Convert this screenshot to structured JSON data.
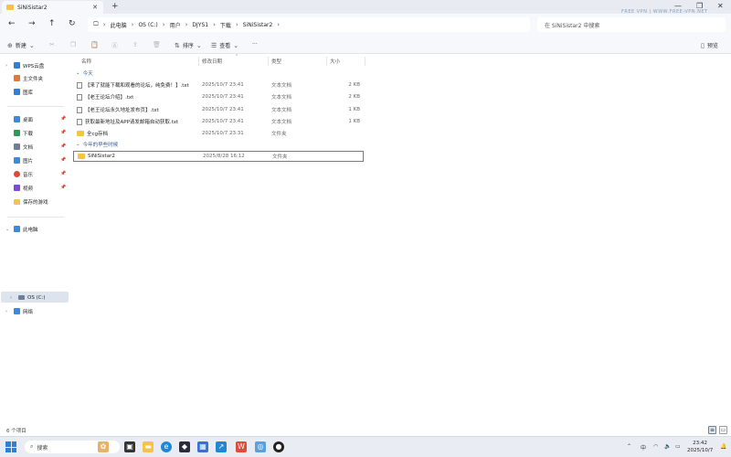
{
  "window": {
    "tab_title": "SiNiSistar2",
    "new_tab_label": "+",
    "watermark": "FREE VPN | WWW.FREE-VPN.NET"
  },
  "nav": {
    "breadcrumbs": [
      "此电脑",
      "OS (C:)",
      "用户",
      "DJYS1",
      "下载",
      "SiNiSistar2"
    ],
    "search_placeholder": "在 SiNiSistar2 中搜索"
  },
  "toolbar": {
    "new_label": "新建",
    "sort_label": "排序",
    "view_label": "查看",
    "more_label": "···",
    "preview_label": "预览"
  },
  "sidebar": {
    "items": [
      {
        "label": "WPS云盘",
        "icon": "cloud-icon",
        "color": "#2f7fd6"
      },
      {
        "label": "主文件夹",
        "icon": "home-icon",
        "color": "#e07a3a"
      },
      {
        "label": "图库",
        "icon": "gallery-icon",
        "color": "#2f7fd6"
      },
      {
        "label": "桌面",
        "icon": "desktop-icon",
        "color": "#3a8be0"
      },
      {
        "label": "下载",
        "icon": "download-icon",
        "color": "#2f9a58"
      },
      {
        "label": "文档",
        "icon": "document-icon",
        "color": "#6f7f95"
      },
      {
        "label": "图片",
        "icon": "picture-icon",
        "color": "#3a8be0"
      },
      {
        "label": "音乐",
        "icon": "music-icon",
        "color": "#e04a3a"
      },
      {
        "label": "视频",
        "icon": "video-icon",
        "color": "#7a4ae0"
      },
      {
        "label": "保存的游戏",
        "icon": "folder-icon",
        "color": "#f6c34a"
      },
      {
        "label": "此电脑",
        "icon": "computer-icon",
        "color": "#3a8be0"
      },
      {
        "label": "OS (C:)",
        "icon": "drive-icon",
        "color": "#6f7f95"
      },
      {
        "label": "网络",
        "icon": "network-icon",
        "color": "#3a8be0"
      }
    ]
  },
  "list": {
    "columns": [
      "名称",
      "修改日期",
      "类型",
      "大小"
    ],
    "groups": [
      {
        "label": "今天",
        "rows": [
          {
            "name": "【来了就能下载和观看的论坛，纯免费！】.txt",
            "date": "2025/10/7 23:41",
            "type": "文本文档",
            "size": "2 KB",
            "kind": "txt"
          },
          {
            "name": "【老王论坛介绍】.txt",
            "date": "2025/10/7 23:41",
            "type": "文本文档",
            "size": "2 KB",
            "kind": "txt"
          },
          {
            "name": "【老王论坛永久地址发布页】.txt",
            "date": "2025/10/7 23:41",
            "type": "文本文档",
            "size": "1 KB",
            "kind": "txt"
          },
          {
            "name": "获取最新地址及APP请发邮箱自动获取.txt",
            "date": "2025/10/7 23:41",
            "type": "文本文档",
            "size": "1 KB",
            "kind": "txt"
          },
          {
            "name": "全cg存档",
            "date": "2025/10/7 23:31",
            "type": "文件夹",
            "size": "",
            "kind": "folder"
          }
        ]
      },
      {
        "label": "今年的早些时候",
        "rows": [
          {
            "name": "SiNiSistar2",
            "date": "2025/8/28 16:12",
            "type": "文件夹",
            "size": "",
            "kind": "folder"
          }
        ]
      }
    ]
  },
  "status": {
    "count": "6 个项目"
  },
  "taskbar": {
    "search_label": "搜索",
    "ime": "中",
    "time": "23:42",
    "date": "2025/10/7"
  }
}
